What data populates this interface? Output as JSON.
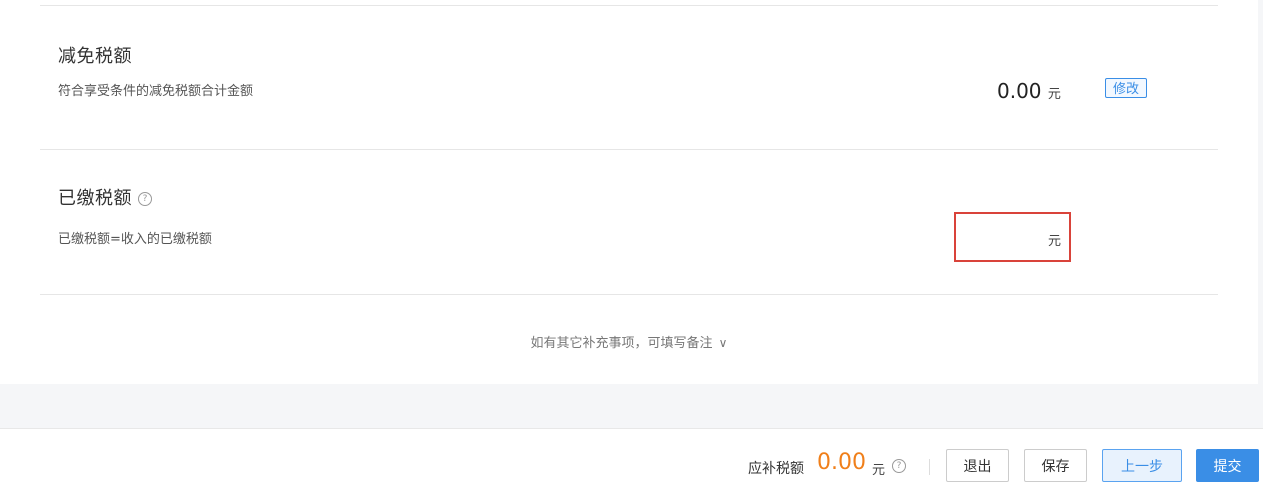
{
  "reduction": {
    "title": "减免税额",
    "description": "符合享受条件的减免税额合计金额",
    "amount": "0.00",
    "unit": "元",
    "edit_label": "修改"
  },
  "paid": {
    "title": "已缴税额",
    "help_glyph": "?",
    "description": "已缴税额=收入的已缴税额",
    "input_value": "",
    "unit": "元"
  },
  "remark": {
    "label": "如有其它补充事项，可填写备注",
    "chevron": "∨"
  },
  "footer": {
    "due_label": "应补税额",
    "due_amount": "0.00",
    "due_unit": "元",
    "help_glyph": "?",
    "buttons": {
      "exit": "退出",
      "save": "保存",
      "prev": "上一步",
      "submit": "提交"
    }
  },
  "colors": {
    "accent": "#3a8ee6",
    "error_border": "#d9433a",
    "due_amount": "#f07f1a"
  }
}
